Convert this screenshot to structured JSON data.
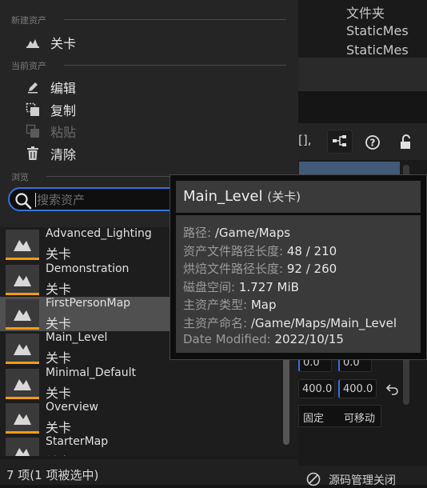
{
  "menu": {
    "section_new": "新建资产",
    "item_level": "关卡",
    "section_current": "当前资产",
    "item_edit": "编辑",
    "item_copy": "复制",
    "item_paste": "粘贴",
    "item_clear": "清除",
    "section_browse": "浏览"
  },
  "search": {
    "placeholder": "搜索资产"
  },
  "assets": [
    {
      "name": "Advanced_Lighting",
      "type": "关卡"
    },
    {
      "name": "Demonstration",
      "type": "关卡"
    },
    {
      "name": "FirstPersonMap",
      "type": "关卡"
    },
    {
      "name": "Main_Level",
      "type": "关卡"
    },
    {
      "name": "Minimal_Default",
      "type": "关卡"
    },
    {
      "name": "Overview",
      "type": "关卡"
    },
    {
      "name": "StarterMap",
      "type": "关卡"
    }
  ],
  "status": "7 项(1 项被选中)",
  "tooltip": {
    "title": "Main_Level",
    "type": "(关卡)",
    "path_k": "路径:",
    "path_v": "/Game/Maps",
    "assetlen_k": "资产文件路径长度:",
    "assetlen_v": "48 / 210",
    "cooklen_k": "烘焙文件路径长度:",
    "cooklen_v": "92 / 260",
    "disk_k": "磁盘空间:",
    "disk_v": "1.727 MiB",
    "ptype_k": "主资产类型:",
    "ptype_v": "Map",
    "pname_k": "主资产命名:",
    "pname_v": "/Game/Maps/Main_Level",
    "date_k": "Date Modified:",
    "date_v": "2022/10/15"
  },
  "background": {
    "type_rows": [
      "文件夹",
      "StaticMes",
      "StaticMes"
    ],
    "field_a1": "0.0",
    "field_a2": "0.0",
    "field_b1": "400.0",
    "field_b2": "400.0",
    "label_fixed": "固定",
    "label_movable": "可移动",
    "toolbar_partial": "[],",
    "source_control": "源码管理关闭"
  },
  "colors": {
    "accent": "#3573d9",
    "level_bar": "#f39c12",
    "selection": "#505050"
  }
}
